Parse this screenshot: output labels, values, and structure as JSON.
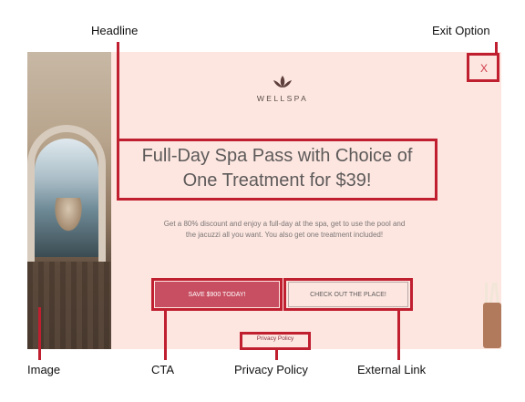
{
  "ad": {
    "brand": "WELLSPA",
    "headline_line1": "Full-Day Spa Pass with Choice of",
    "headline_line2": "One Treatment for $39!",
    "body_line1": "Get a 80% discount and enjoy a full-day at the spa, get to use the pool and",
    "body_line2": "the jacuzzi all you want. You also get one treatment included!",
    "cta_label": "SAVE $900 TODAY!",
    "external_label": "CHECK OUT THE PLACE!",
    "privacy_label": "Privacy Policy",
    "close_label": "X"
  },
  "annotations": {
    "headline": "Headline",
    "exit": "Exit Option",
    "image": "Image",
    "cta": "CTA",
    "privacy": "Privacy Policy",
    "external": "External Link"
  },
  "colors": {
    "annotation": "#c01f30",
    "panel": "#fde6e0",
    "cta": "#c84f62"
  }
}
